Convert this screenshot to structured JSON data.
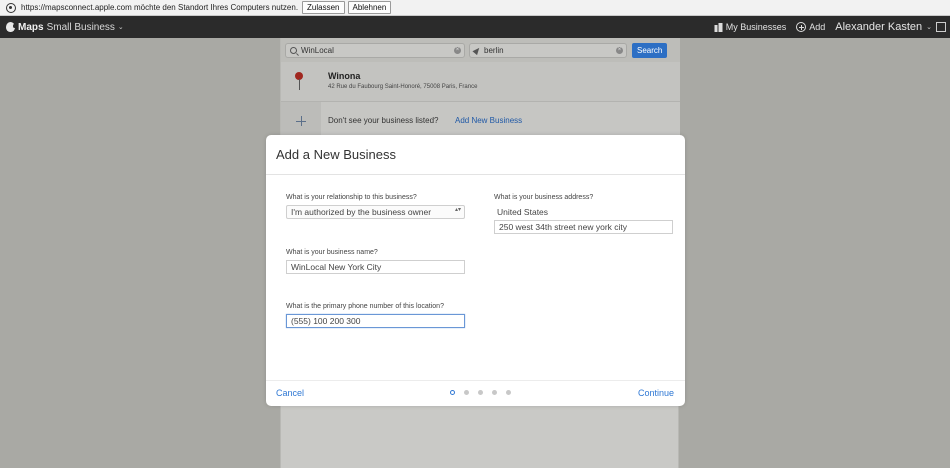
{
  "permission_bar": {
    "message": "https://mapsconnect.apple.com möchte den Standort Ihres Computers nutzen.",
    "allow_label": "Zulassen",
    "deny_label": "Ablehnen"
  },
  "appbar": {
    "brand_bold": "Maps",
    "brand_light": "Small Business",
    "chevron": "⌄",
    "my_businesses": "My Businesses",
    "add": "Add",
    "user_name": "Alexander Kasten",
    "user_chevron": "⌄"
  },
  "search": {
    "what_value": "WinLocal",
    "where_value": "berlin",
    "clear_symbol": "×",
    "button_label": "Search"
  },
  "result": {
    "name": "Winona",
    "address": "42 Rue du Faubourg Saint-Honoré, 75008 Paris, France"
  },
  "add_row": {
    "question": "Don't see your business listed?",
    "link": "Add New Business"
  },
  "modal": {
    "title": "Add a New Business",
    "relationship_label": "What is your relationship to this business?",
    "relationship_value": "I'm authorized by the business owner",
    "updown": "▴▾",
    "name_label": "What is your business name?",
    "name_value": "WinLocal New York City",
    "phone_label": "What is the primary phone number of this location?",
    "phone_value": "(555) 100 200 300",
    "address_label": "What is your business address?",
    "country": "United States",
    "street_value": "250 west 34th street new york city",
    "cancel_label": "Cancel",
    "continue_label": "Continue",
    "step_current": 1,
    "step_total": 5
  },
  "colors": {
    "accent": "#2f78d4",
    "search_button": "#2d6fc4",
    "appbar_bg": "#2b2b2b"
  }
}
